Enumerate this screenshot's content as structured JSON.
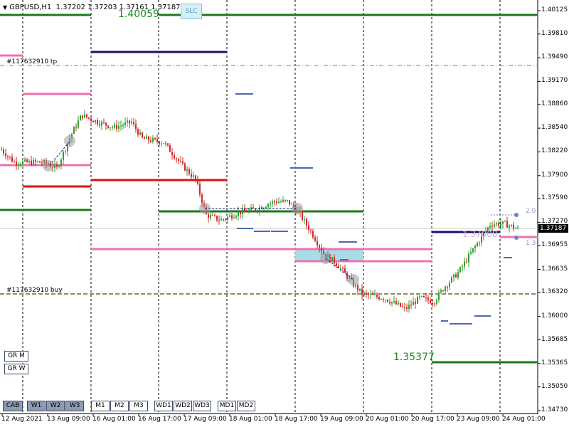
{
  "window": {
    "symbol_title": "GBPUSD,H1",
    "ohlc": "1.37202 1.37203 1.37161 1.37187",
    "slc_label": "SLC"
  },
  "price_axis": {
    "ticks": [
      "1.40125",
      "1.39810",
      "1.39490",
      "1.39170",
      "1.38860",
      "1.38540",
      "1.38220",
      "1.37900",
      "1.37590",
      "1.37270",
      "1.36955",
      "1.36635",
      "1.36320",
      "1.36000",
      "1.35685",
      "1.35365",
      "1.35050",
      "1.34730"
    ],
    "current_price": "1.37187"
  },
  "time_axis": {
    "ticks": [
      "12 Aug 2021",
      "13 Aug 09:00",
      "16 Aug 01:00",
      "16 Aug 17:00",
      "17 Aug 09:00",
      "18 Aug 01:00",
      "18 Aug 17:00",
      "19 Aug 09:00",
      "20 Aug 01:00",
      "20 Aug 17:00",
      "23 Aug 09:00",
      "24 Aug 01:00"
    ]
  },
  "annotations": {
    "level_high": "1.40059",
    "level_low": "1.35377",
    "tp_label": "#117632910 tp",
    "buy_label": "#117632910 buy",
    "right_top": "2.0",
    "right_bottom": "1.3",
    "faded_price": "1.37008"
  },
  "buttons": {
    "side": [
      "GR M",
      "GR W"
    ],
    "bottom": [
      {
        "label": "CAB",
        "on": true
      },
      {
        "label": "W1",
        "on": true
      },
      {
        "label": "W2",
        "on": true
      },
      {
        "label": "W3",
        "on": true
      },
      {
        "label": "M1",
        "on": false
      },
      {
        "label": "M2",
        "on": false
      },
      {
        "label": "M3",
        "on": false
      },
      {
        "label": "WD1",
        "on": false
      },
      {
        "label": "WD2",
        "on": false
      },
      {
        "label": "WD3",
        "on": false
      },
      {
        "label": "MD1",
        "on": false
      },
      {
        "label": "MD2",
        "on": false
      }
    ]
  },
  "colors": {
    "green_level": "#1a7a1a",
    "navy_level": "#14146e",
    "red_level": "#e01010",
    "pink_level": "#f070b0",
    "bull_candle": "#2ca02c",
    "bear_candle": "#d62728",
    "zone_fill": "#a8dde8"
  }
}
